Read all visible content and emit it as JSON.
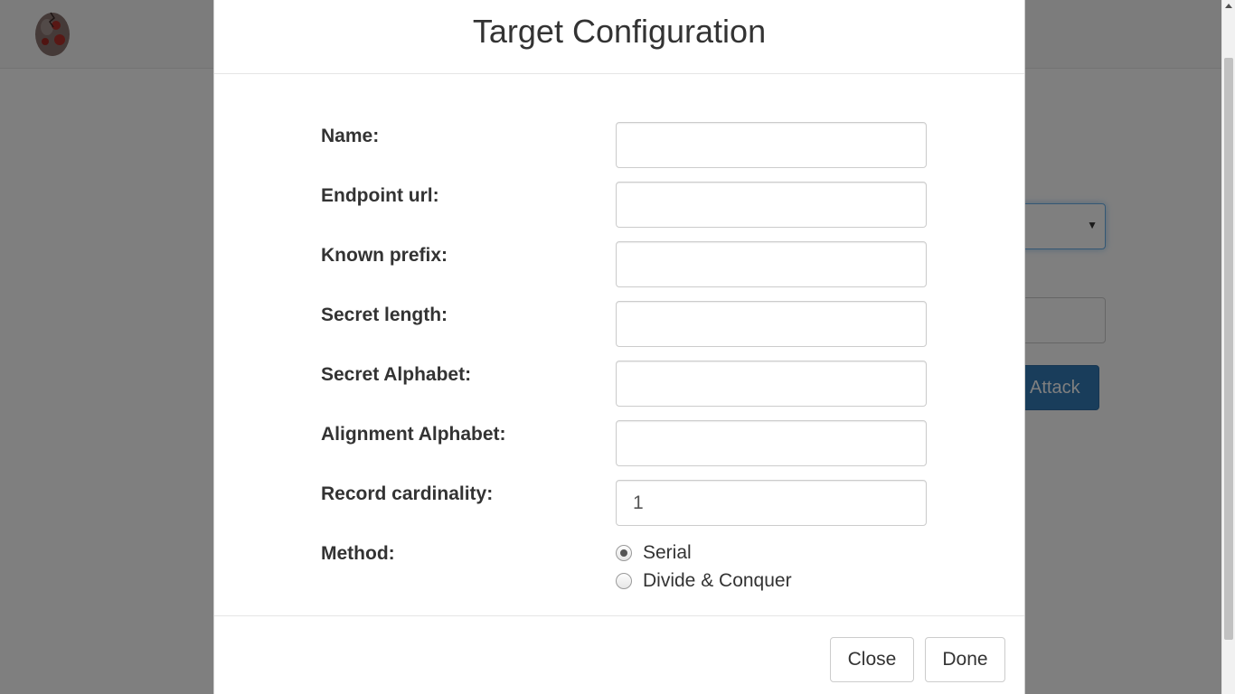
{
  "modal": {
    "title": "Target Configuration",
    "fields": [
      {
        "label": "Name:",
        "value": ""
      },
      {
        "label": "Endpoint url:",
        "value": ""
      },
      {
        "label": "Known prefix:",
        "value": ""
      },
      {
        "label": "Secret length:",
        "value": ""
      },
      {
        "label": "Secret Alphabet:",
        "value": ""
      },
      {
        "label": "Alignment Alphabet:",
        "value": ""
      },
      {
        "label": "Record cardinality:",
        "value": "1"
      }
    ],
    "method": {
      "label": "Method:",
      "options": [
        {
          "label": "Serial",
          "checked": true
        },
        {
          "label": "Divide & Conquer",
          "checked": false
        }
      ]
    },
    "buttons": {
      "close": "Close",
      "done": "Done"
    }
  },
  "background": {
    "attack_button": "Attack",
    "select_caret": "▼",
    "accent_color": "#337ab7"
  }
}
